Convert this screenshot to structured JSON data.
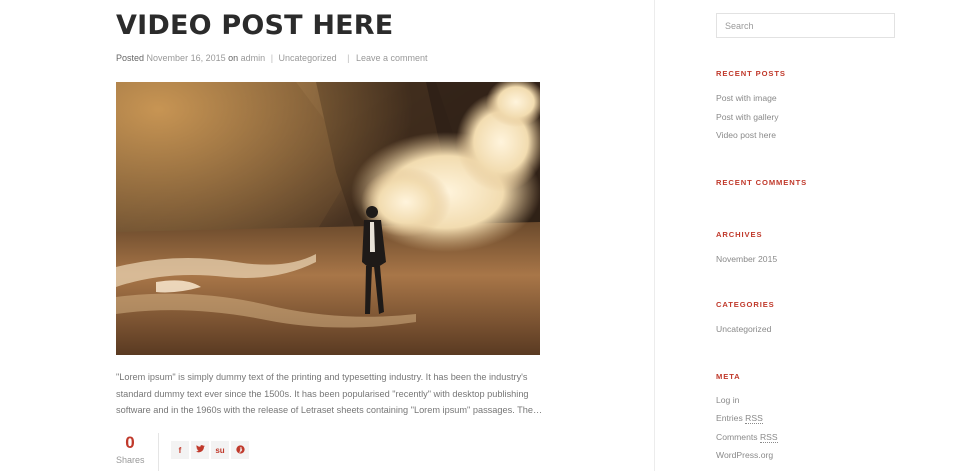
{
  "post": {
    "title": "VIDEO POST HERE",
    "meta": {
      "posted_label": "Posted",
      "date": "November 16, 2015",
      "on_label": "on",
      "author": "admin",
      "separator": "|",
      "category": "Uncategorized",
      "comment_link": "Leave a comment"
    },
    "excerpt": "\"Lorem ipsum\" is simply dummy text of the printing and typesetting industry. It has been the industry's standard dummy text ever since the 1500s. It has been popularised \"recently\" with desktop publishing software and in the 1960s with the release of Letraset sheets containing \"Lorem ipsum\" passages. The…"
  },
  "share": {
    "count": "0",
    "label": "Shares",
    "buttons": [
      {
        "icon": "facebook-icon",
        "glyph": "f"
      },
      {
        "icon": "twitter-icon",
        "glyph": "t"
      },
      {
        "icon": "stumbleupon-icon",
        "glyph": "su"
      },
      {
        "icon": "pinterest-icon",
        "glyph": "p"
      }
    ]
  },
  "sidebar": {
    "search_placeholder": "Search",
    "recent_posts": {
      "title": "RECENT POSTS",
      "items": [
        "Post with image",
        "Post with gallery",
        "Video post here"
      ]
    },
    "recent_comments": {
      "title": "RECENT COMMENTS"
    },
    "archives": {
      "title": "ARCHIVES",
      "items": [
        "November 2015"
      ]
    },
    "categories": {
      "title": "CATEGORIES",
      "items": [
        "Uncategorized"
      ]
    },
    "meta": {
      "title": "META",
      "log_in": "Log in",
      "entries_prefix": "Entries",
      "comments_prefix": "Comments",
      "rss": "RSS",
      "wordpress": "WordPress.org"
    }
  },
  "colors": {
    "accent": "#c0392b",
    "title": "#2b2b2b",
    "muted_text": "#8a8a8a"
  }
}
